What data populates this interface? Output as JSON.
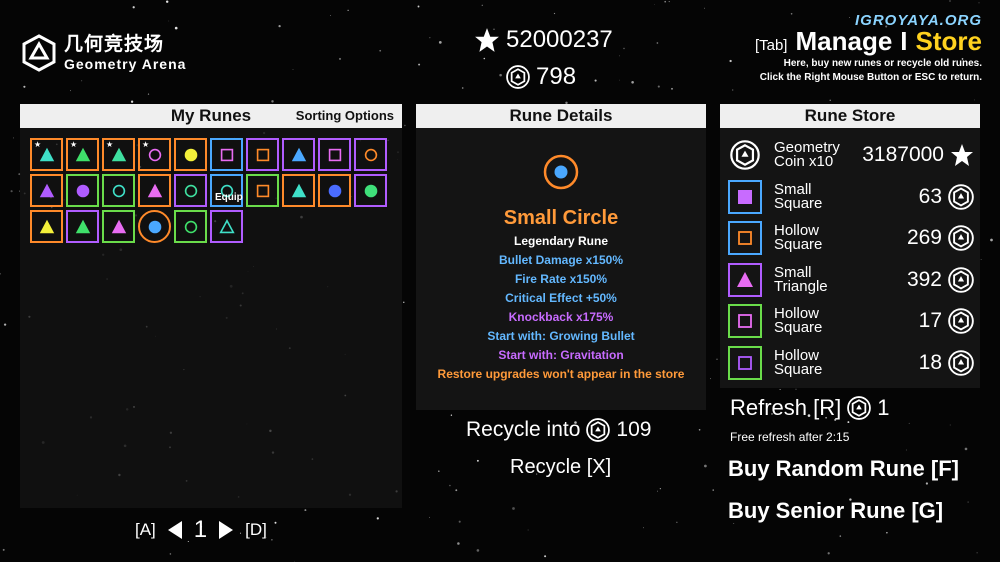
{
  "watermark": "IGROYAYA.ORG",
  "logo": {
    "cn": "几何竞技场",
    "en": "Geometry Arena"
  },
  "currency": {
    "stars": "52000237",
    "coins": "798"
  },
  "header": {
    "tab_key": "[Tab]",
    "manage": "Manage",
    "sep": "I",
    "store": "Store",
    "hint1": "Here, buy new runes or recycle old runes.",
    "hint2": "Click the Right Mouse Button or ESC to return."
  },
  "my_runes": {
    "title": "My Runes",
    "sorting": "Sorting Options",
    "equip": "Equip",
    "cells": [
      {
        "frame": "#ff8a2a",
        "shape": "triangle",
        "color": "#3fe0c8",
        "mark": "★"
      },
      {
        "frame": "#ff8a2a",
        "shape": "triangle",
        "color": "#3fe06a",
        "mark": "★"
      },
      {
        "frame": "#ff8a2a",
        "shape": "triangle",
        "color": "#3fe0a0",
        "mark": "★"
      },
      {
        "frame": "#ff8a2a",
        "shape": "ring",
        "color": "#e86cf2",
        "mark": "★"
      },
      {
        "frame": "#ff8a2a",
        "shape": "dot",
        "color": "#f4f03a",
        "mark": ""
      },
      {
        "frame": "#4aa8ff",
        "shape": "square",
        "color": "#e86cf2",
        "mark": ""
      },
      {
        "frame": "#b05cff",
        "shape": "square",
        "color": "#ff8a2a",
        "mark": ""
      },
      {
        "frame": "#b05cff",
        "shape": "triangle",
        "color": "#4aa8ff",
        "mark": ""
      },
      {
        "frame": "#b05cff",
        "shape": "square",
        "color": "#e86cf2",
        "mark": ""
      },
      {
        "frame": "#b05cff",
        "shape": "ring",
        "color": "#ff8a2a",
        "mark": ""
      },
      {
        "frame": "#ff8a2a",
        "shape": "triangle",
        "color": "#b05cff",
        "mark": ""
      },
      {
        "frame": "#6adc4a",
        "shape": "dot",
        "color": "#b05cff",
        "mark": ""
      },
      {
        "frame": "#6adc4a",
        "shape": "ring",
        "color": "#3fe0c8",
        "mark": ""
      },
      {
        "frame": "#ff8a2a",
        "shape": "triangle",
        "color": "#e86cf2",
        "mark": ""
      },
      {
        "frame": "#b05cff",
        "shape": "ring",
        "color": "#3fe0a0",
        "mark": ""
      },
      {
        "frame": "#4aa8ff",
        "shape": "ring",
        "color": "#3fe0c8",
        "mark": ""
      },
      {
        "frame": "#6adc4a",
        "shape": "square",
        "color": "#ff8a2a",
        "mark": ""
      },
      {
        "frame": "#ff8a2a",
        "shape": "triangle",
        "color": "#3fe0c8",
        "mark": ""
      },
      {
        "frame": "#ff8a2a",
        "shape": "dot",
        "color": "#4a6cff",
        "mark": ""
      },
      {
        "frame": "#b05cff",
        "shape": "dot",
        "color": "#3fe07a",
        "mark": ""
      },
      {
        "frame": "#ff8a2a",
        "shape": "triangle",
        "color": "#f4f03a",
        "mark": ""
      },
      {
        "frame": "#b05cff",
        "shape": "triangle",
        "color": "#3fe06a",
        "mark": ""
      },
      {
        "frame": "#6adc4a",
        "shape": "triangle",
        "color": "#e86cf2",
        "mark": ""
      },
      {
        "frame": "#ff8a2a",
        "shape": "dot",
        "color": "#4aa8ff",
        "mark": "",
        "circleFrame": true
      },
      {
        "frame": "#6adc4a",
        "shape": "ring",
        "color": "#3fe06a",
        "mark": ""
      },
      {
        "frame": "#b05cff",
        "shape": "tri-outline",
        "color": "#3fe0c8",
        "mark": ""
      }
    ]
  },
  "details": {
    "title": "Rune Details",
    "name": "Small Circle",
    "rarity": "Legendary Rune",
    "stats": [
      {
        "text": "Bullet Damage x150%",
        "color": "#63b8ff"
      },
      {
        "text": "Fire Rate x150%",
        "color": "#63b8ff"
      },
      {
        "text": "Critical Effect +50%",
        "color": "#63b8ff"
      },
      {
        "text": "Knockback x175%",
        "color": "#c86bff"
      },
      {
        "text": "Start with: Growing Bullet",
        "color": "#63b8ff"
      },
      {
        "text": "Start with: Gravitation",
        "color": "#c86bff"
      },
      {
        "text": "Restore upgrades won't appear in the store",
        "color": "#ff9a3a"
      }
    ],
    "recycle_into": "Recycle into",
    "recycle_value": "109",
    "recycle_btn": "Recycle [X]"
  },
  "store": {
    "title": "Rune Store",
    "items": [
      {
        "name": "Geometry Coin x10",
        "price": "3187000",
        "currency": "star",
        "frame": "",
        "shape": "coin",
        "color": "#ffffff"
      },
      {
        "name": "Small Square",
        "price": "63",
        "currency": "coin",
        "frame": "#4aa8ff",
        "shape": "square-fill",
        "color": "#c86bff"
      },
      {
        "name": "Hollow Square",
        "price": "269",
        "currency": "coin",
        "frame": "#4aa8ff",
        "shape": "square",
        "color": "#ff8a2a"
      },
      {
        "name": "Small Triangle",
        "price": "392",
        "currency": "coin",
        "frame": "#b05cff",
        "shape": "triangle",
        "color": "#e86cf2"
      },
      {
        "name": "Hollow Square",
        "price": "17",
        "currency": "coin",
        "frame": "#6adc4a",
        "shape": "square",
        "color": "#e86cf2"
      },
      {
        "name": "Hollow Square",
        "price": "18",
        "currency": "coin",
        "frame": "#6adc4a",
        "shape": "square",
        "color": "#b05cff"
      }
    ],
    "refresh": "Refresh [R]",
    "refresh_cost": "1",
    "free_refresh": "Free refresh after 2:15",
    "buy_random": "Buy Random Rune [F]",
    "buy_senior": "Buy Senior Rune [G]"
  },
  "pager": {
    "prev_key": "[A]",
    "page": "1",
    "next_key": "[D]"
  }
}
